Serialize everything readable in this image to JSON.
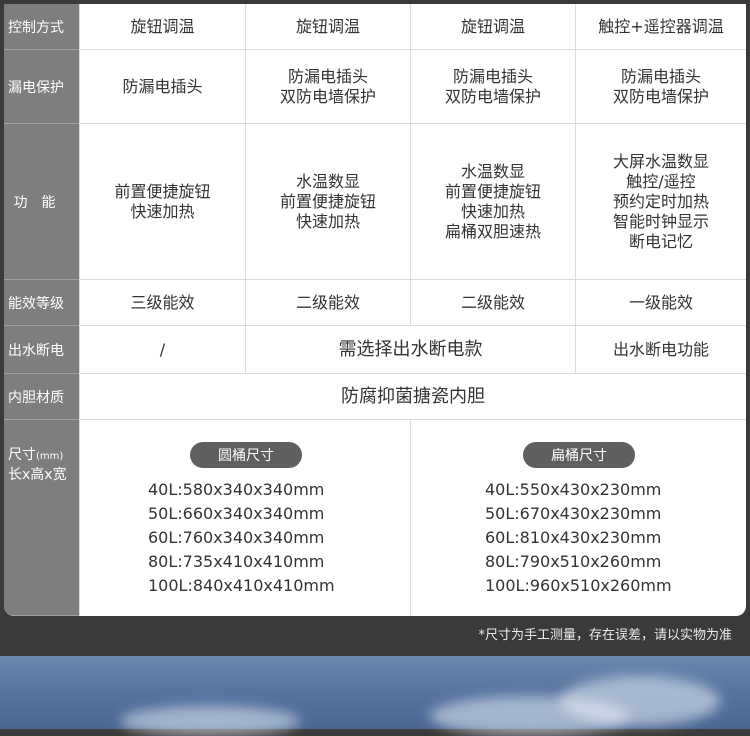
{
  "rows": {
    "control": {
      "label": "控制方式",
      "cells": [
        "旋钮调温",
        "旋钮调温",
        "旋钮调温",
        "触控+遥控器调温"
      ]
    },
    "leakage": {
      "label": "漏电保护",
      "cells": [
        "防漏电插头",
        "防漏电插头\n双防电墙保护",
        "防漏电插头\n双防电墙保护",
        "防漏电插头\n双防电墙保护"
      ]
    },
    "function": {
      "label": "功能",
      "cells": [
        "前置便捷旋钮\n快速加热",
        "水温数显\n前置便捷旋钮\n快速加热",
        "水温数显\n前置便捷旋钮\n快速加热\n扁桶双胆速热",
        "大屏水温数显\n触控/遥控\n预约定时加热\n智能时钟显示\n断电记忆"
      ]
    },
    "efficiency": {
      "label": "能效等级",
      "cells": [
        "三级能效",
        "二级能效",
        "二级能效",
        "一级能效"
      ]
    },
    "water_cutoff": {
      "label": "出水断电",
      "cells": [
        "/",
        "需选择出水断电款",
        "出水断电功能"
      ]
    },
    "liner": {
      "label": "内胆材质",
      "value": "防腐抑菌搪瓷内胆"
    },
    "size": {
      "label_line1": "尺寸",
      "label_unit": "(mm)",
      "label_line2": "长x高x宽",
      "round": {
        "title": "圆桶尺寸",
        "items": [
          "40L:580x340x340mm",
          "50L:660x340x340mm",
          "60L:760x340x340mm",
          "80L:735x410x410mm",
          "100L:840x410x410mm"
        ]
      },
      "flat": {
        "title": "扁桶尺寸",
        "items": [
          "40L:550x430x230mm",
          "50L:670x430x230mm",
          "60L:810x430x230mm",
          "80L:790x510x260mm",
          "100L:960x510x260mm"
        ]
      }
    }
  },
  "footnote": "*尺寸为手工测量，存在误差，请以实物为准",
  "colors": {
    "label_bg": "#7e7e7e",
    "pill_bg": "#5f5f5f",
    "page_bg": "#3a3a3a",
    "sky": "#5a77a2"
  }
}
